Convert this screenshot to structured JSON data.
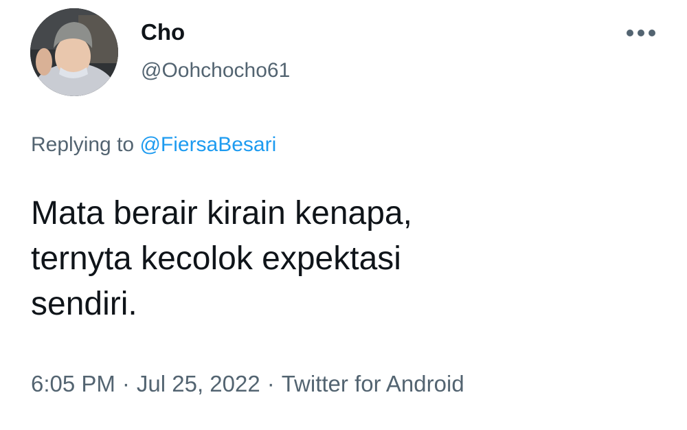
{
  "author": {
    "display_name": "Cho",
    "handle": "@Oohchocho61",
    "avatar": "profile-photo"
  },
  "more_icon": "three-dots-horizontal",
  "reply": {
    "prefix": "Replying to",
    "mention": "@FiersaBesari"
  },
  "tweet": {
    "lines": [
      "Mata berair kirain kenapa,",
      "ternyta kecolok expektasi",
      "sendiri."
    ]
  },
  "meta": {
    "time": "6:05 PM",
    "separator": "·",
    "date": "Jul 25, 2022",
    "source": "Twitter for Android"
  },
  "colors": {
    "text": "#0f1419",
    "secondary": "#536471",
    "link": "#1d9bf0"
  }
}
